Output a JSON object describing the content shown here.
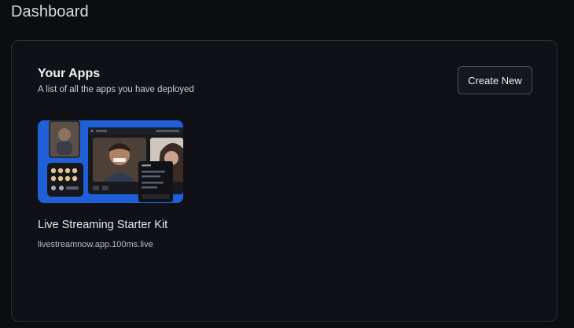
{
  "header": {
    "title": "Dashboard"
  },
  "apps_panel": {
    "title": "Your Apps",
    "subtitle": "A list of all the apps you have deployed",
    "create_button_label": "Create New"
  },
  "apps": [
    {
      "name": "Live Streaming Starter Kit",
      "url": "livestreamnow.app.100ms.live",
      "thumbnail": "live-streaming-app-preview"
    }
  ],
  "colors": {
    "background": "#0c0d10",
    "panel": "#101116",
    "panel_border": "#2b2e36",
    "thumbnail_accent": "#1f5fd8"
  }
}
